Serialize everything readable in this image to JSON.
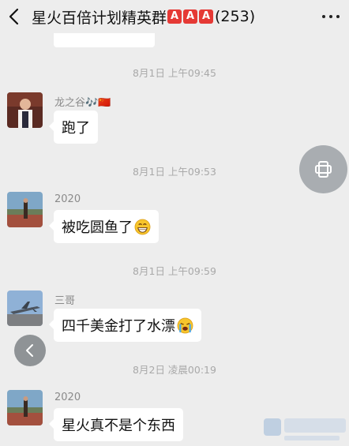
{
  "header": {
    "back_icon": "chevron-left-icon",
    "title": "星火百倍计划精英群",
    "badges": [
      "A",
      "A",
      "A"
    ],
    "count": "(253)",
    "more_icon": "more-dots-icon"
  },
  "messages": [
    {
      "time": "8月1日 上午09:45",
      "sender": "龙之谷🎶🇨🇳",
      "text": "跑了",
      "emoji": ""
    },
    {
      "time": "8月1日 上午09:53",
      "sender": "2020",
      "text": "被吃圆鱼了",
      "emoji": "grinning-face-icon"
    },
    {
      "time": "8月1日 上午09:59",
      "sender": "三哥",
      "text": "四千美金打了水漂",
      "emoji": "crying-face-icon"
    },
    {
      "time": "8月2日 凌晨00:19",
      "sender": "2020",
      "text": "星火真不是个东西",
      "emoji": ""
    }
  ],
  "floating": {
    "switch_device_icon": "phone-rotate-icon",
    "back_icon": "chevron-left-icon"
  },
  "colors": {
    "background": "#ededed",
    "bubble": "#ffffff",
    "timestamp": "#a9a9a9",
    "badge": "#e53935"
  }
}
